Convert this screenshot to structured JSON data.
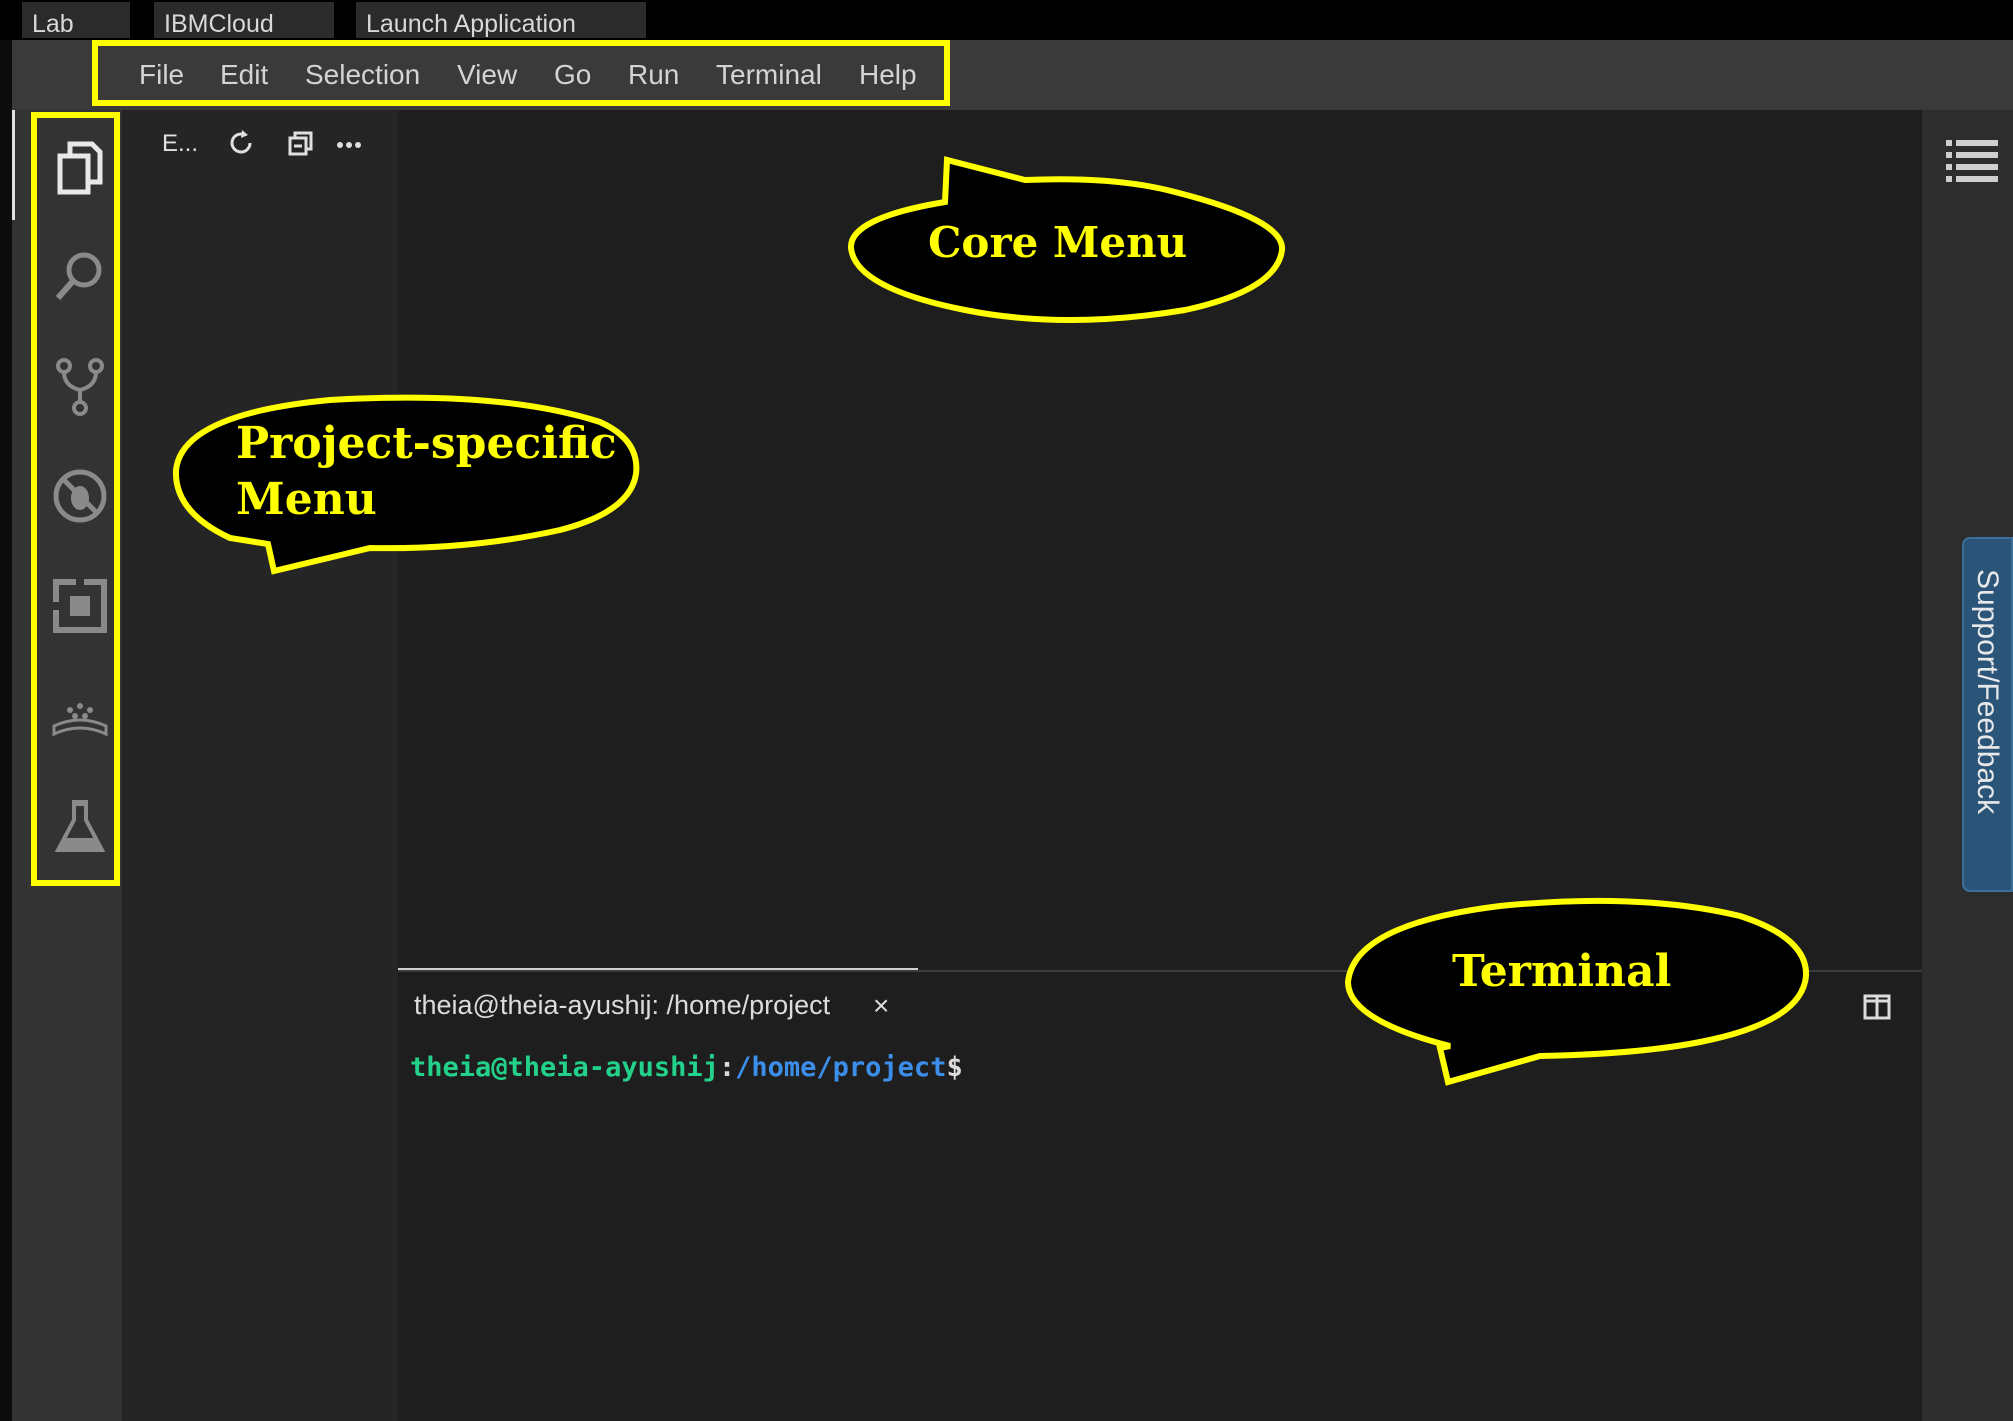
{
  "browser_tabs": [
    "Lab",
    "IBMCloud",
    "Launch Application"
  ],
  "menu": [
    "File",
    "Edit",
    "Selection",
    "View",
    "Go",
    "Run",
    "Terminal",
    "Help"
  ],
  "activity_icons": [
    "explorer-icon",
    "search-icon",
    "source-control-icon",
    "debug-icon",
    "extensions-icon",
    "skills-network-icon",
    "flask-icon"
  ],
  "explorer": {
    "title": "E...",
    "actions": [
      "refresh-icon",
      "collapse-all-icon",
      "more-icon"
    ]
  },
  "right_icon": "outline-icon",
  "terminal": {
    "tab_label": "theia@theia-ayushij: /home/project",
    "close": "×",
    "prompt_user": "theia@theia-ayushij",
    "prompt_sep": ":",
    "prompt_path": "/home/project",
    "prompt_dollar": "$",
    "split_icon": "split-terminal-icon"
  },
  "support_tab": "Support/Feedback",
  "annotations": {
    "core_menu": "Core Menu",
    "project_menu_line1": "Project-specific",
    "project_menu_line2": "Menu",
    "terminal": "Terminal",
    "color": "#ffff00"
  },
  "colors": {
    "prompt_user": "#23d18b",
    "prompt_path": "#3b8eea",
    "support_bg": "#2a5579"
  }
}
